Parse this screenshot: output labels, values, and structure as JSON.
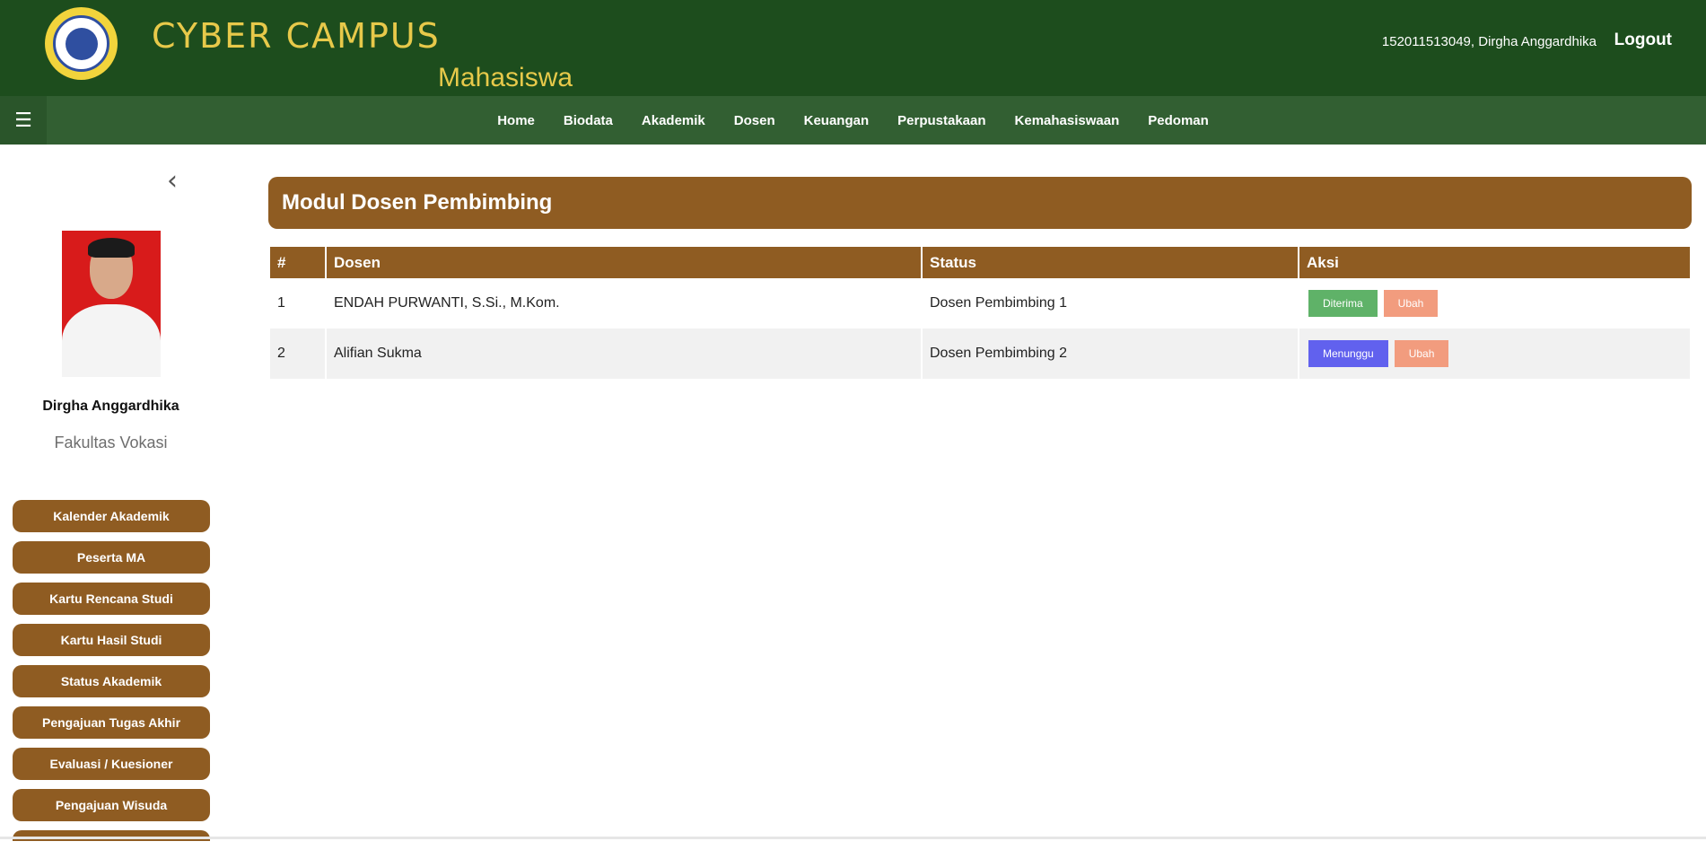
{
  "header": {
    "brand": "CYBER CAMPUS",
    "subbrand": "Mahasiswa",
    "user_info": "152011513049, Dirgha Anggardhika",
    "logout_label": "Logout"
  },
  "nav": {
    "menu_icon": "hamburger-icon",
    "items": [
      {
        "label": "Home"
      },
      {
        "label": "Biodata"
      },
      {
        "label": "Akademik"
      },
      {
        "label": "Dosen"
      },
      {
        "label": "Keuangan"
      },
      {
        "label": "Perpustakaan"
      },
      {
        "label": "Kemahasiswaan"
      },
      {
        "label": "Pedoman"
      }
    ]
  },
  "sidebar": {
    "collapse_icon": "chevron-left-icon",
    "student_name": "Dirgha Anggardhika",
    "faculty": "Fakultas Vokasi",
    "menu": [
      {
        "label": "Kalender Akademik"
      },
      {
        "label": "Peserta MA"
      },
      {
        "label": "Kartu Rencana Studi"
      },
      {
        "label": "Kartu Hasil Studi"
      },
      {
        "label": "Status Akademik"
      },
      {
        "label": "Pengajuan Tugas Akhir"
      },
      {
        "label": "Evaluasi / Kuesioner"
      },
      {
        "label": "Pengajuan Wisuda"
      }
    ]
  },
  "main": {
    "title": "Modul Dosen Pembimbing",
    "table": {
      "headers": [
        "#",
        "Dosen",
        "Status",
        "Aksi"
      ],
      "rows": [
        {
          "no": "1",
          "dosen": "ENDAH PURWANTI, S.Si., M.Kom.",
          "status": "Dosen Pembimbing 1",
          "state_label": "Diterima",
          "edit_label": "Ubah"
        },
        {
          "no": "2",
          "dosen": "Alifian Sukma",
          "status": "Dosen Pembimbing 2",
          "state_label": "Menunggu",
          "edit_label": "Ubah"
        }
      ]
    }
  },
  "colors": {
    "header_bg": "#1d4d1d",
    "nav_bg": "#325f32",
    "brand_gold": "#e7c94a",
    "accent_brown": "#8f5c22",
    "status_accepted": "#5fb268",
    "status_waiting": "#6161ee",
    "edit_button": "#f29c7e"
  }
}
